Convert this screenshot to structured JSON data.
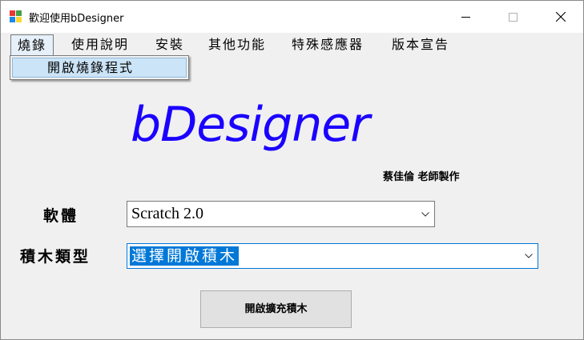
{
  "window": {
    "title": "歡迎使用bDesigner"
  },
  "menu": {
    "items": [
      {
        "label": "燒錄"
      },
      {
        "label": "使用說明"
      },
      {
        "label": "安裝"
      },
      {
        "label": "其他功能"
      },
      {
        "label": "特殊感應器"
      },
      {
        "label": "版本宣告"
      }
    ],
    "dropdown": {
      "item": "開啟燒錄程式"
    }
  },
  "logo": {
    "text": "bDesigner",
    "color": "#1a00ff"
  },
  "author": "蔡佳倫 老師製作",
  "form": {
    "software_label": "軟體",
    "software_value": "Scratch 2.0",
    "blocktype_label": "積木類型",
    "blocktype_value": "選擇開啟積木",
    "button_label": "開啟擴充積木"
  },
  "colors": {
    "accent": "#0078d7",
    "highlight": "#cce4f7"
  },
  "icons": {
    "app": "app-icon",
    "minimize": "minimize-icon",
    "maximize": "maximize-icon",
    "close": "close-icon",
    "dropdown": "chevron-down-icon"
  }
}
